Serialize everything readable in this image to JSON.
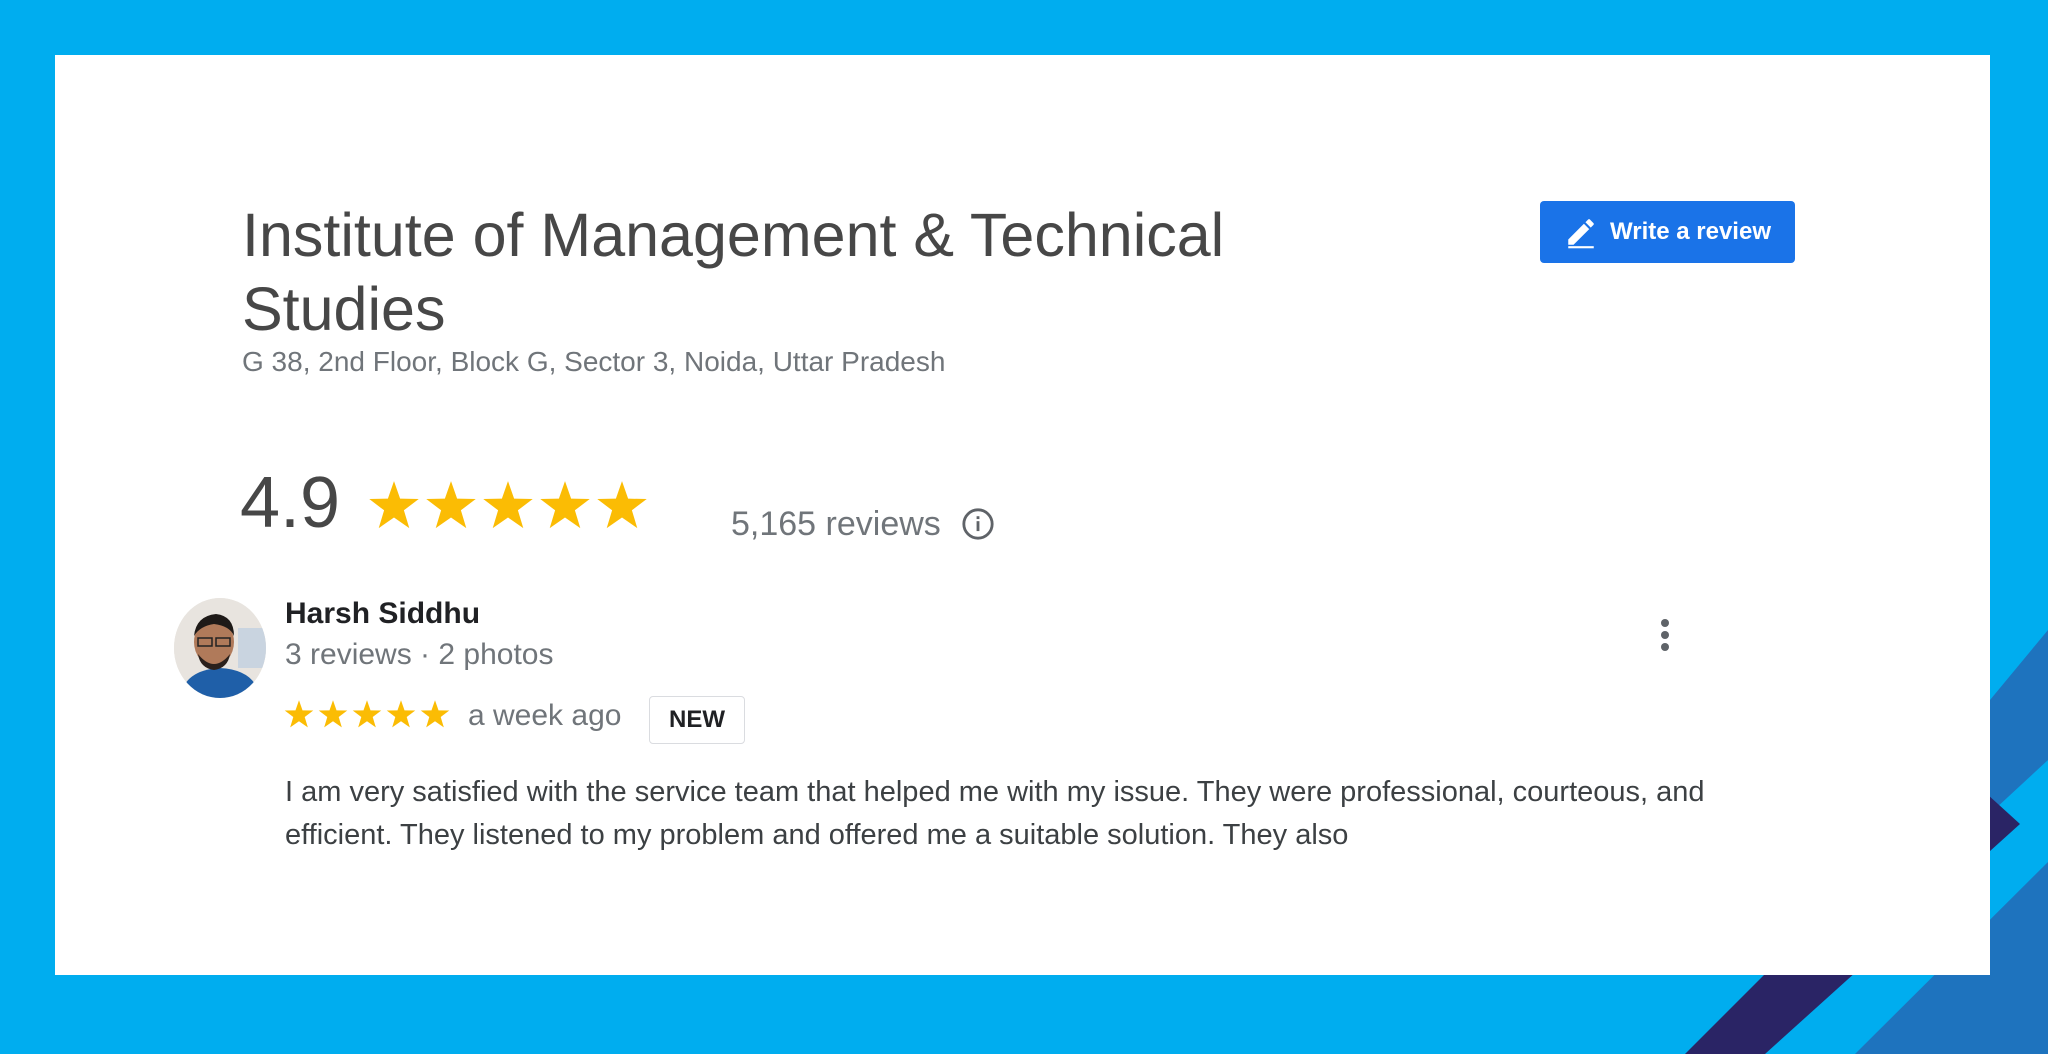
{
  "business": {
    "name": "Institute of Management & Technical Studies",
    "address": "G 38, 2nd Floor, Block G, Sector 3, Noida, Uttar Pradesh",
    "rating": "4.9",
    "rating_value": 4.9,
    "rating_max": 5,
    "review_count": "5,165 reviews"
  },
  "actions": {
    "write_review_label": "Write a review",
    "write_review_icon": "pencil-icon",
    "info_icon": "info-icon",
    "more_icon": "more-vert-icon"
  },
  "review": {
    "author": "Harsh Siddhu",
    "author_meta": "3 reviews · 2 photos",
    "stars": 5,
    "time": "a week ago",
    "badge": "NEW",
    "text": "I am very satisfied with the service team that helped me with my issue. They were professional, courteous, and efficient. They listened to my problem and offered me a suitable solution. They also"
  },
  "colors": {
    "background": "#00adef",
    "star": "#fbbc04",
    "button": "#1a73e8",
    "decor_dark": "#2a2465",
    "decor_mid": "#1e73be"
  }
}
